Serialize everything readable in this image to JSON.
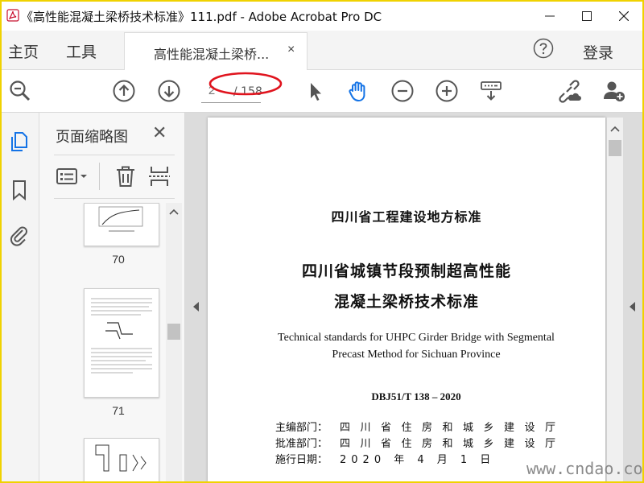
{
  "window": {
    "title": "《高性能混凝土梁桥技术标准》111.pdf - Adobe Acrobat Pro DC"
  },
  "menu": {
    "home": "主页",
    "tools": "工具",
    "tab_title": "高性能混凝土梁桥...",
    "tab_close": "×",
    "login": "登录"
  },
  "toolbar": {
    "current_page": "2",
    "page_total": "/ 158"
  },
  "thumbnails": {
    "title": "页面缩略图",
    "close": "✕",
    "pages": [
      {
        "label": "70"
      },
      {
        "label": "71"
      }
    ]
  },
  "document": {
    "header": "四川省工程建设地方标准",
    "title_line1": "四川省城镇节段预制超高性能",
    "title_line2": "混凝土梁桥技术标准",
    "en_line1": "Technical standards for UHPC Girder Bridge with Segmental",
    "en_line2": "Precast Method for Sichuan Province",
    "code": "DBJ51/T 138 – 2020",
    "meta": [
      {
        "label": "主编部门：",
        "value": "四川省住房和城乡建设厅"
      },
      {
        "label": "批准部门：",
        "value": "四川省住房和城乡建设厅"
      },
      {
        "label": "施行日期：",
        "value": "2020 年 4 月 1 日"
      }
    ]
  },
  "watermark": "www.cndao.com",
  "colors": {
    "border": "#f0d200",
    "accent_blue": "#1473e6",
    "annotation_red": "#e0141e"
  }
}
